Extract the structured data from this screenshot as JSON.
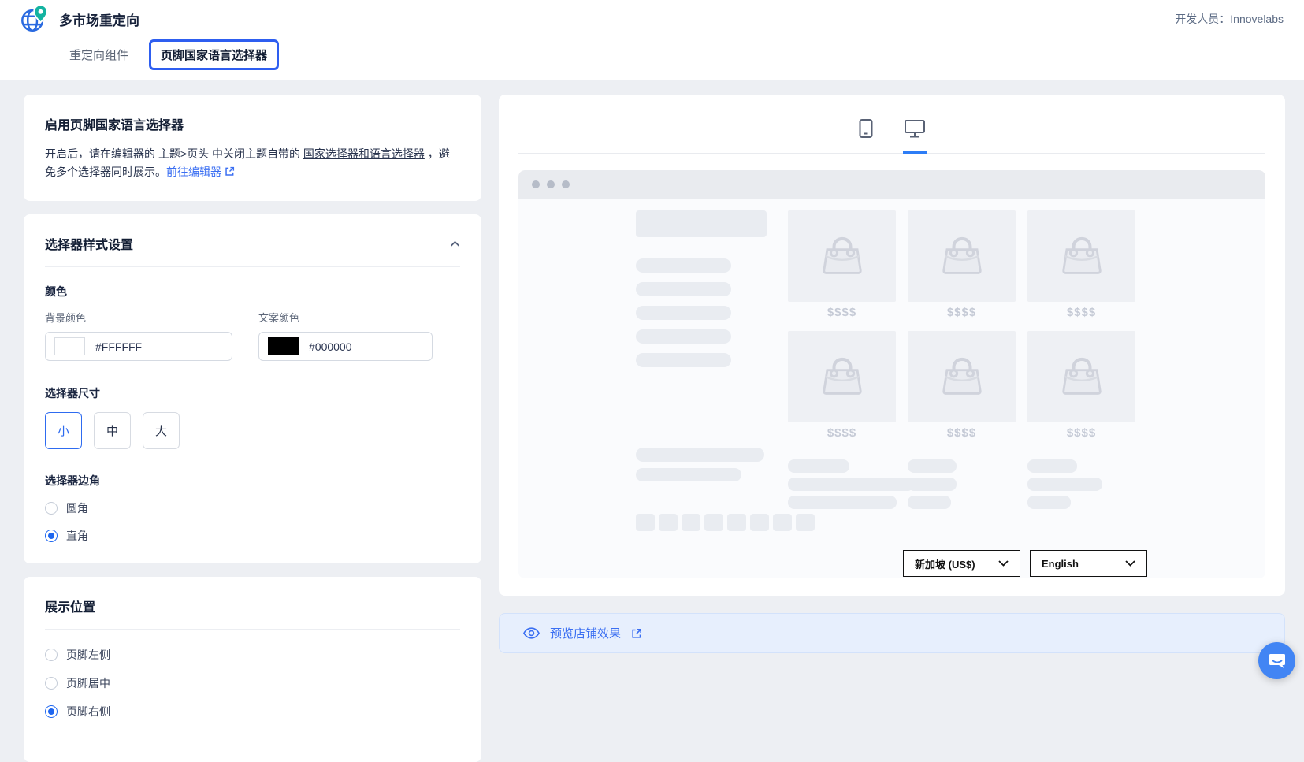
{
  "header": {
    "app_title": "多市场重定向",
    "developer_label": "开发人员：Innovelabs"
  },
  "tabs": [
    {
      "label": "重定向组件",
      "active": false
    },
    {
      "label": "页脚国家语言选择器",
      "active": true
    }
  ],
  "enable_card": {
    "title": "启用页脚国家语言选择器",
    "desc_part1": "开启后，请在编辑器的 主题>页头 中关闭主题自带的 ",
    "desc_underline": "国家选择器和语言选择器",
    "desc_part2": " ，避免多个选择器同时展示。",
    "link_label": "前往编辑器"
  },
  "style_card": {
    "title": "选择器样式设置",
    "color_section_label": "颜色",
    "bg_color_label": "背景颜色",
    "bg_color_value": "#FFFFFF",
    "text_color_label": "文案颜色",
    "text_color_value": "#000000",
    "size_label": "选择器尺寸",
    "sizes": [
      {
        "label": "小",
        "selected": true
      },
      {
        "label": "中",
        "selected": false
      },
      {
        "label": "大",
        "selected": false
      }
    ],
    "corner_label": "选择器边角",
    "corner_options": [
      {
        "label": "圆角",
        "selected": false
      },
      {
        "label": "直角",
        "selected": true
      }
    ]
  },
  "position_card": {
    "title": "展示位置",
    "options": [
      {
        "label": "页脚左侧",
        "selected": false
      },
      {
        "label": "页脚居中",
        "selected": false
      },
      {
        "label": "页脚右侧",
        "selected": true
      }
    ]
  },
  "preview": {
    "price_placeholder": "$$$$",
    "country_selector_value": "新加坡 (US$)",
    "language_selector_value": "English",
    "preview_link_label": "预览店铺效果"
  },
  "colors": {
    "accent_blue": "#2e5ef0",
    "link_blue": "#3b6ff2",
    "radio_blue": "#1e66f0",
    "preview_bar_bg": "#e7effd",
    "chat_bubble": "#4285f4",
    "skeleton": "#e9ecf1",
    "page_bg": "#edeff3"
  },
  "icons": {
    "logo": "globe-with-pin-icon",
    "device_mobile": "mobile-icon",
    "device_desktop": "desktop-icon"
  }
}
